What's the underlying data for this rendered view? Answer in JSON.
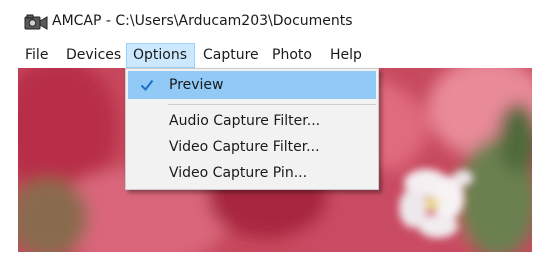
{
  "window": {
    "title": "AMCAP - C:\\Users\\Arducam203\\Documents",
    "icon": "camera-app-icon"
  },
  "menubar": {
    "items": [
      {
        "label": "File"
      },
      {
        "label": "Devices"
      },
      {
        "label": "Options",
        "active": true
      },
      {
        "label": "Capture"
      },
      {
        "label": "Photo"
      },
      {
        "label": "Help"
      }
    ]
  },
  "options_menu": {
    "items": [
      {
        "label": "Preview",
        "checked": true,
        "highlighted": true
      },
      {
        "label": "Audio Capture Filter..."
      },
      {
        "label": "Video Capture Filter..."
      },
      {
        "label": "Video Capture Pin..."
      }
    ]
  },
  "colors": {
    "menu_active_bg": "#cce8ff",
    "menu_highlight_bg": "#91c9f7",
    "dropdown_bg": "#f2f2f2",
    "check_color": "#1f6fc5"
  }
}
